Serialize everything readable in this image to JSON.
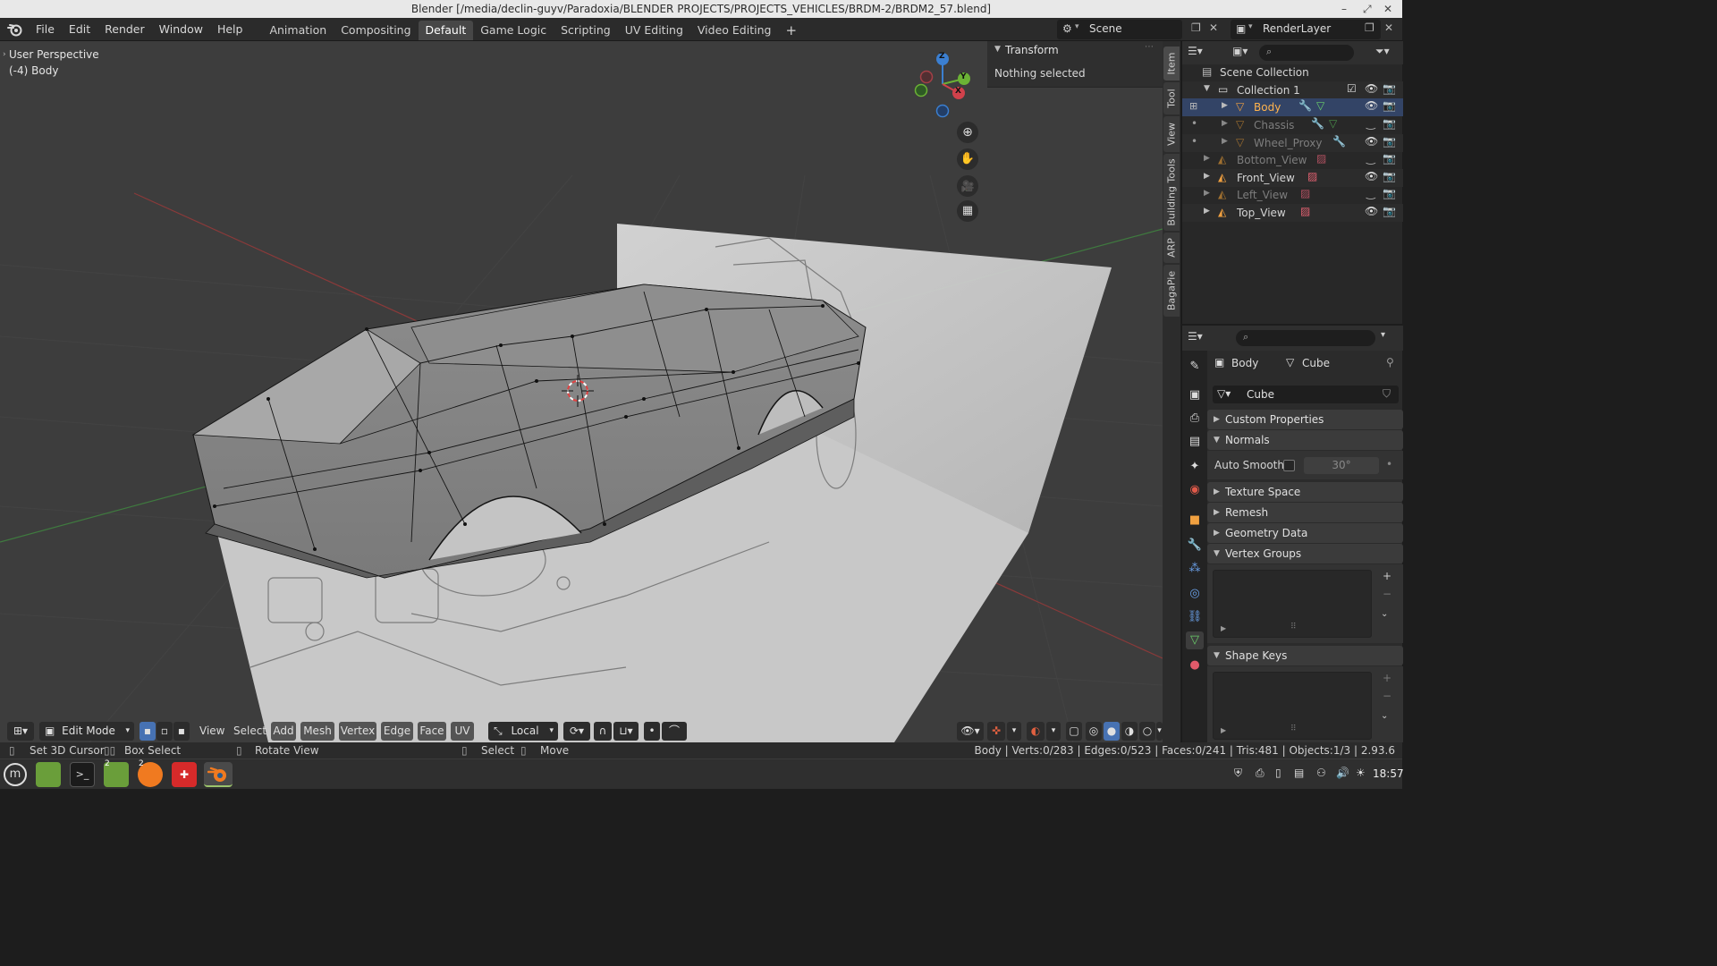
{
  "window": {
    "title": "Blender [/media/declin-guyv/Paradoxia/BLENDER PROJECTS/PROJECTS_VEHICLES/BRDM-2/BRDM2_57.blend]",
    "controls": [
      "–",
      "⤢",
      "✕"
    ]
  },
  "menu": [
    "File",
    "Edit",
    "Render",
    "Window",
    "Help"
  ],
  "workspaces": [
    {
      "label": "Animation",
      "active": false
    },
    {
      "label": "Compositing",
      "active": false
    },
    {
      "label": "Default",
      "active": true
    },
    {
      "label": "Game Logic",
      "active": false
    },
    {
      "label": "Scripting",
      "active": false
    },
    {
      "label": "UV Editing",
      "active": false
    },
    {
      "label": "Video Editing",
      "active": false
    }
  ],
  "add_workspace_label": "+",
  "scene": {
    "label": "Scene",
    "render_layer": "RenderLayer"
  },
  "viewport": {
    "perspective": "User Perspective",
    "object_info": "(-4) Body",
    "gizmo_axes": {
      "z": "Z",
      "y": "Y",
      "x": "X"
    }
  },
  "sidebar": {
    "tabs": [
      "Item",
      "Tool",
      "View",
      "Building Tools",
      "ARP",
      "BagaPie"
    ],
    "transform_title": "Transform",
    "transform_body": "Nothing selected"
  },
  "outliner": {
    "rows": [
      {
        "label": "Scene Collection",
        "type": "scene",
        "indent": 0
      },
      {
        "label": "Collection 1",
        "type": "collection",
        "indent": 1
      },
      {
        "label": "Body",
        "type": "mesh",
        "indent": 2,
        "selected": true,
        "visible": true
      },
      {
        "label": "Chassis",
        "type": "mesh",
        "indent": 2,
        "dim": true,
        "visible": false
      },
      {
        "label": "Wheel_Proxy",
        "type": "mesh",
        "indent": 2,
        "dim": true,
        "visible": true
      },
      {
        "label": "Bottom_View",
        "type": "image",
        "indent": 1,
        "dim": true,
        "visible": false
      },
      {
        "label": "Front_View",
        "type": "image",
        "indent": 1,
        "visible": true
      },
      {
        "label": "Left_View",
        "type": "image",
        "indent": 1,
        "dim": true,
        "visible": false
      },
      {
        "label": "Top_View",
        "type": "image",
        "indent": 1,
        "visible": true
      }
    ]
  },
  "properties": {
    "breadcrumb_object": "Body",
    "breadcrumb_data": "Cube",
    "data_name": "Cube",
    "panels": {
      "custom_properties": "Custom Properties",
      "normals": "Normals",
      "auto_smooth_label": "Auto Smooth",
      "auto_smooth_angle": "30°",
      "texture_space": "Texture Space",
      "remesh": "Remesh",
      "geometry_data": "Geometry Data",
      "vertex_groups": "Vertex Groups",
      "shape_keys": "Shape Keys"
    }
  },
  "viewport_header": {
    "mode": "Edit Mode",
    "menus": [
      "View",
      "Select",
      "Add",
      "Mesh",
      "Vertex",
      "Edge",
      "Face",
      "UV"
    ],
    "orientation": "Local"
  },
  "statusbar": {
    "left": [
      {
        "label": "Set 3D Cursor"
      },
      {
        "label": "Box Select"
      },
      {
        "label": "Rotate View"
      },
      {
        "label": "Select"
      },
      {
        "label": "Move"
      }
    ],
    "stats": "Body | Verts:0/283 | Edges:0/523 | Faces:0/241 | Tris:481 | Objects:1/3 | 2.93.6"
  },
  "taskbar": {
    "time": "18:57",
    "badges": [
      "2",
      "2"
    ]
  },
  "colors": {
    "selected_object": "#ffb34d",
    "accent_blue": "#4772b3",
    "x_axis": "#d1414b",
    "y_axis": "#6bb235",
    "z_axis": "#3b7fd1"
  }
}
